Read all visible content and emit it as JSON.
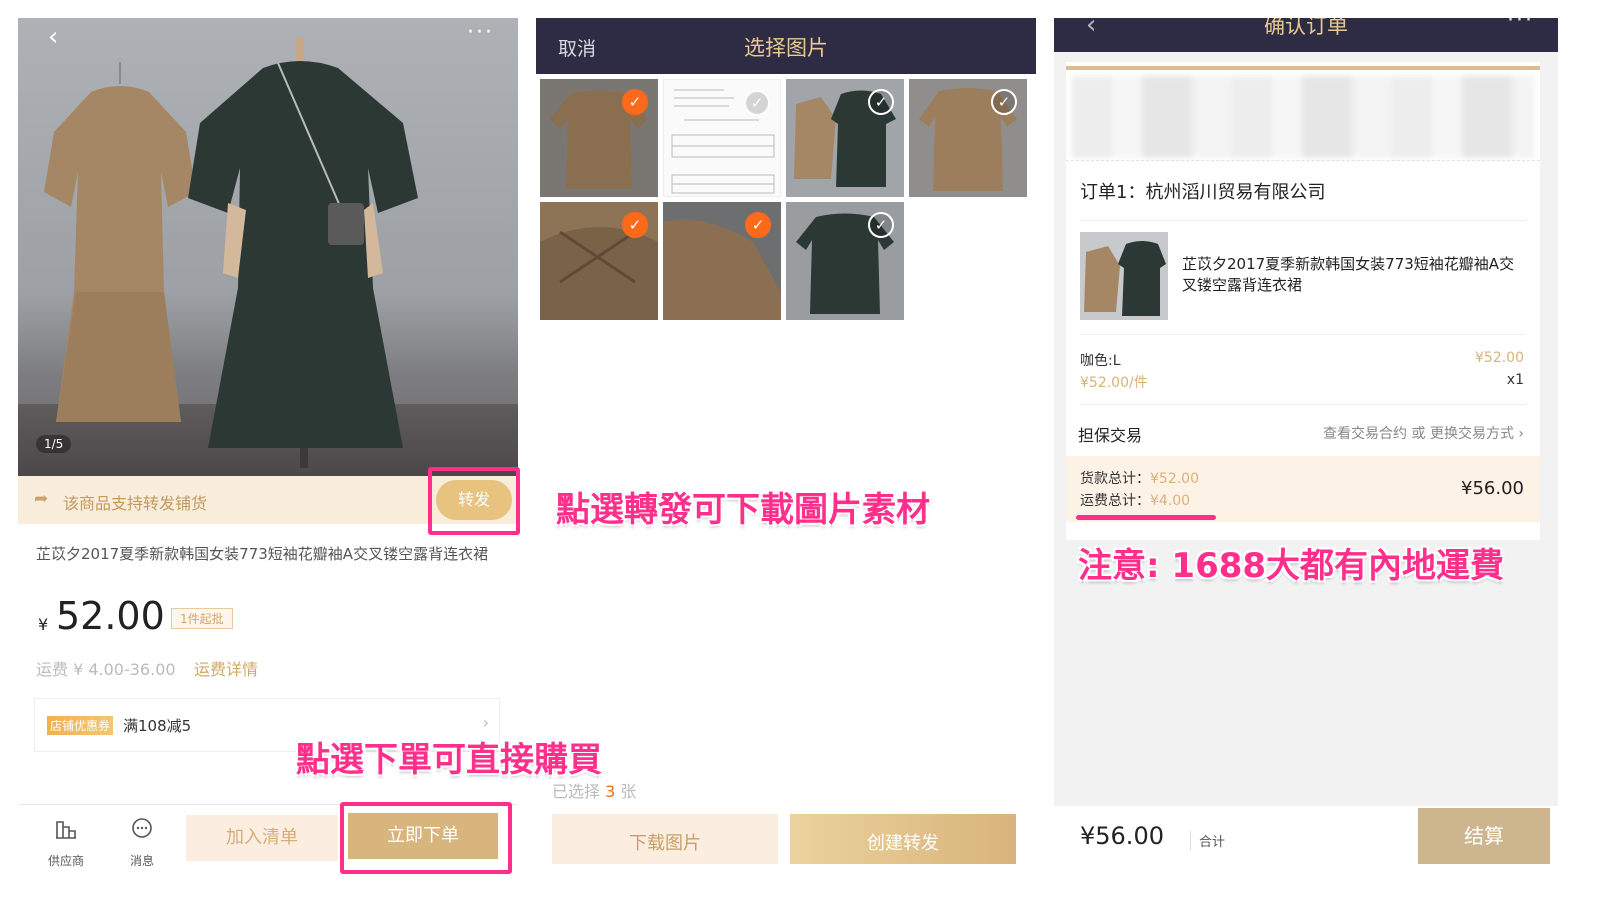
{
  "product_page": {
    "image_counter": "1/5",
    "forward_banner": "该商品支持转发铺货",
    "forward_button": "转发",
    "title": "芷苡夕2017夏季新款韩国女装773短袖花瓣袖A交叉镂空露背连衣裙",
    "price_currency": "¥",
    "price": "52.00",
    "moq_badge": "1件起批",
    "shipping": "运费 ¥ 4.00-36.00",
    "shipping_link": "运费详情",
    "coupon_tag": "店铺优惠券",
    "coupon_text": "满108减5",
    "tab_supplier": "供应商",
    "tab_message": "消息",
    "add_list": "加入清单",
    "order_now": "立即下单"
  },
  "picker_page": {
    "cancel": "取消",
    "title": "选择图片",
    "thumbnails": [
      {
        "kind": "dresses-tan-front",
        "selected": true
      },
      {
        "kind": "size-chart",
        "selected": false
      },
      {
        "kind": "dresses-pair",
        "selected": false
      },
      {
        "kind": "dress-tan-back",
        "selected": false
      },
      {
        "kind": "detail-neck",
        "selected": true
      },
      {
        "kind": "detail-sleeve",
        "selected": true
      },
      {
        "kind": "dress-green-back",
        "selected": false
      }
    ],
    "selected_prefix": "已选择",
    "selected_count": "3",
    "selected_suffix": "张",
    "download_button": "下载图片",
    "create_forward_button": "创建转发"
  },
  "confirm_page": {
    "title": "确认订单",
    "order_header": "订单1：杭州滔川贸易有限公司",
    "item_name": "芷苡夕2017夏季新款韩国女装773短袖花瓣袖A交叉镂空露背连衣裙",
    "spec": "咖色:L",
    "unit_price": "¥52.00/件",
    "line_total": "¥52.00",
    "quantity": "x1",
    "escrow": "担保交易",
    "escrow_link": "查看交易合约 或 更换交易方式 ›",
    "goods_total_label": "货款总计：",
    "goods_total": "¥52.00",
    "freight_total_label": "运费总计：",
    "freight_total": "¥4.00",
    "sum_total": "¥56.00",
    "grand_total": "¥56.00",
    "grand_label": "合计",
    "checkout": "结算"
  },
  "annotations": {
    "forward_note": "點選轉發可下載圖片素材",
    "order_note": "點選下單可直接購買",
    "shipping_note": "注意: 1688大都有內地運費"
  },
  "colors": {
    "accent_gold": "#d9b57e",
    "header_dark": "#2e2b45",
    "selected_orange": "#ff6a1a",
    "annotation_pink": "#ff2f8b"
  }
}
